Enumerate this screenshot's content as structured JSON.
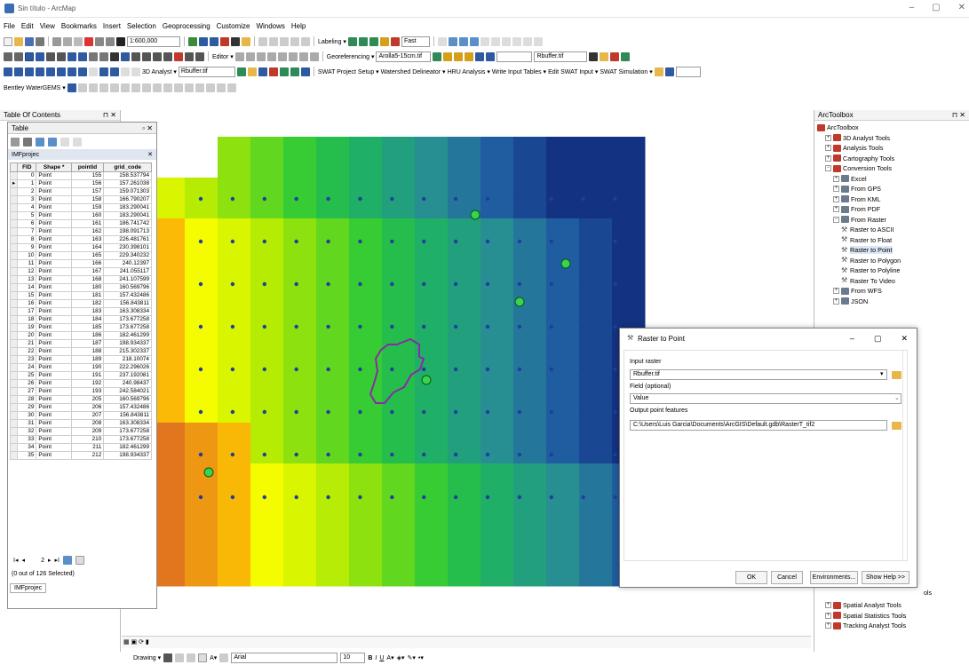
{
  "window": {
    "title": "Sin título - ArcMap"
  },
  "menu": [
    "File",
    "Edit",
    "View",
    "Bookmarks",
    "Insert",
    "Selection",
    "Geoprocessing",
    "Customize",
    "Windows",
    "Help"
  ],
  "toolbars": {
    "scale": "1:600,000",
    "labeling": "Labeling ▾",
    "fast": "Fast",
    "editor": "Editor ▾",
    "georeferencing": "Georeferencing ▾",
    "georef_layer": "Arolla5-15cm.tif",
    "raster_layer": "Rbuffer.tif",
    "analyst3d": "3D Analyst ▾",
    "analyst_layer": "Rbuffer.tif",
    "swat": [
      "SWAT Project Setup ▾",
      "Watershed Delineator ▾",
      "HRU Analysis ▾",
      "Write Input Tables ▾",
      "Edit SWAT Input ▾",
      "SWAT Simulation ▾"
    ],
    "bentley": "Bentley WaterGEMS ▾"
  },
  "toc": {
    "title": "Table Of Contents"
  },
  "table": {
    "title": "Table",
    "layer": "IMFprojec",
    "columns": [
      "FID",
      "Shape *",
      "pointid",
      "grid_code"
    ],
    "rows": [
      [
        "0",
        "Point",
        "155",
        "158.537794"
      ],
      [
        "1",
        "Point",
        "156",
        "157.261038"
      ],
      [
        "2",
        "Point",
        "157",
        "159.071303"
      ],
      [
        "3",
        "Point",
        "158",
        "166.790207"
      ],
      [
        "4",
        "Point",
        "159",
        "183.290041"
      ],
      [
        "5",
        "Point",
        "160",
        "183.290041"
      ],
      [
        "6",
        "Point",
        "161",
        "186.741742"
      ],
      [
        "7",
        "Point",
        "162",
        "198.091713"
      ],
      [
        "8",
        "Point",
        "163",
        "226.481761"
      ],
      [
        "9",
        "Point",
        "164",
        "230.398101"
      ],
      [
        "10",
        "Point",
        "165",
        "229.340232"
      ],
      [
        "11",
        "Point",
        "166",
        "240.12397"
      ],
      [
        "12",
        "Point",
        "167",
        "241.055117"
      ],
      [
        "13",
        "Point",
        "168",
        "241.107599"
      ],
      [
        "14",
        "Point",
        "180",
        "160.569796"
      ],
      [
        "15",
        "Point",
        "181",
        "157.432486"
      ],
      [
        "16",
        "Point",
        "182",
        "156.843811"
      ],
      [
        "17",
        "Point",
        "183",
        "163.308334"
      ],
      [
        "18",
        "Point",
        "184",
        "173.677258"
      ],
      [
        "19",
        "Point",
        "185",
        "173.677258"
      ],
      [
        "20",
        "Point",
        "186",
        "182.461299"
      ],
      [
        "21",
        "Point",
        "187",
        "198.934337"
      ],
      [
        "22",
        "Point",
        "188",
        "215.302337"
      ],
      [
        "23",
        "Point",
        "189",
        "218.10074"
      ],
      [
        "24",
        "Point",
        "190",
        "222.296026"
      ],
      [
        "25",
        "Point",
        "191",
        "237.192081"
      ],
      [
        "26",
        "Point",
        "192",
        "240.98437"
      ],
      [
        "27",
        "Point",
        "193",
        "242.584021"
      ],
      [
        "28",
        "Point",
        "205",
        "160.569796"
      ],
      [
        "29",
        "Point",
        "206",
        "157.432486"
      ],
      [
        "30",
        "Point",
        "207",
        "156.843811"
      ],
      [
        "31",
        "Point",
        "208",
        "163.308334"
      ],
      [
        "32",
        "Point",
        "209",
        "173.677258"
      ],
      [
        "33",
        "Point",
        "210",
        "173.677258"
      ],
      [
        "34",
        "Point",
        "211",
        "182.461299"
      ],
      [
        "35",
        "Point",
        "212",
        "198.934337"
      ]
    ],
    "record": "2",
    "selected": "(0 out of 126 Selected)",
    "tab": "IMFprojec"
  },
  "toolbox": {
    "title": "ArcToolbox",
    "items": [
      {
        "label": "ArcToolbox",
        "level": 0,
        "kind": "root"
      },
      {
        "label": "3D Analyst Tools",
        "level": 1,
        "kind": "box",
        "pm": "+"
      },
      {
        "label": "Analysis Tools",
        "level": 1,
        "kind": "box",
        "pm": "+"
      },
      {
        "label": "Cartography Tools",
        "level": 1,
        "kind": "box",
        "pm": "+"
      },
      {
        "label": "Conversion Tools",
        "level": 1,
        "kind": "box",
        "pm": "−"
      },
      {
        "label": "Excel",
        "level": 2,
        "kind": "set",
        "pm": "+"
      },
      {
        "label": "From GPS",
        "level": 2,
        "kind": "set",
        "pm": "+"
      },
      {
        "label": "From KML",
        "level": 2,
        "kind": "set",
        "pm": "+"
      },
      {
        "label": "From PDF",
        "level": 2,
        "kind": "set",
        "pm": "+"
      },
      {
        "label": "From Raster",
        "level": 2,
        "kind": "set",
        "pm": "−"
      },
      {
        "label": "Raster to ASCII",
        "level": 3,
        "kind": "tool"
      },
      {
        "label": "Raster to Float",
        "level": 3,
        "kind": "tool"
      },
      {
        "label": "Raster to Point",
        "level": 3,
        "kind": "tool"
      },
      {
        "label": "Raster to Polygon",
        "level": 3,
        "kind": "tool"
      },
      {
        "label": "Raster to Polyline",
        "level": 3,
        "kind": "tool"
      },
      {
        "label": "Raster To Video",
        "level": 3,
        "kind": "tool"
      },
      {
        "label": "From WFS",
        "level": 2,
        "kind": "set",
        "pm": "+"
      },
      {
        "label": "JSON",
        "level": 2,
        "kind": "set",
        "pm": "+"
      }
    ],
    "bottom_items": [
      "Spatial Analyst Tools",
      "Spatial Statistics Tools",
      "Tracking Analyst Tools"
    ],
    "partial_tools": "ols"
  },
  "dialog": {
    "title": "Raster to Point",
    "input_label": "Input raster",
    "input_value": "Rbuffer.tif",
    "field_label": "Field (optional)",
    "field_value": "Value",
    "output_label": "Output point features",
    "output_value": "C:\\Users\\Luis Garcia\\Documents\\ArcGIS\\Default.gdb\\RasterT_tif2",
    "ok": "OK",
    "cancel": "Cancel",
    "env": "Environments...",
    "help": "Show Help >>"
  },
  "bottom": {
    "drawing": "Drawing ▾",
    "font": "Arial",
    "size": "10"
  },
  "colors": {
    "accent": "#1e5aa8",
    "watershed": "#8a2aa8",
    "highlight_point": "#39d353"
  }
}
